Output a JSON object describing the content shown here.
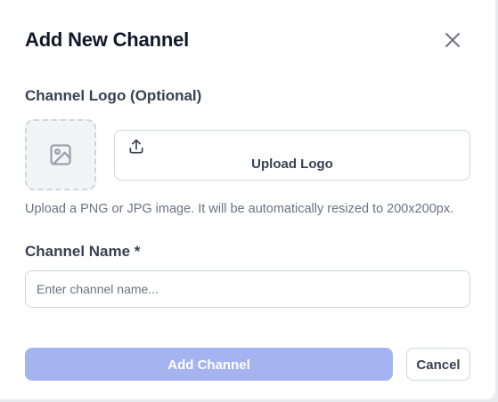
{
  "dialog": {
    "title": "Add New Channel",
    "close_icon": "close-icon"
  },
  "logo_section": {
    "label": "Channel Logo (Optional)",
    "placeholder_icon": "image-icon",
    "upload_icon": "upload-icon",
    "upload_label": "Upload Logo",
    "hint": "Upload a PNG or JPG image. It will be automatically resized to 200x200px."
  },
  "name_section": {
    "label": "Channel Name *",
    "input_value": "",
    "input_placeholder": "Enter channel name..."
  },
  "actions": {
    "primary_label": "Add Channel",
    "primary_disabled": true,
    "secondary_label": "Cancel"
  },
  "colors": {
    "primary_disabled_bg": "#a5b4f0",
    "text_dark": "#111827",
    "text_muted": "#6b7280",
    "border": "#d1d5db"
  }
}
